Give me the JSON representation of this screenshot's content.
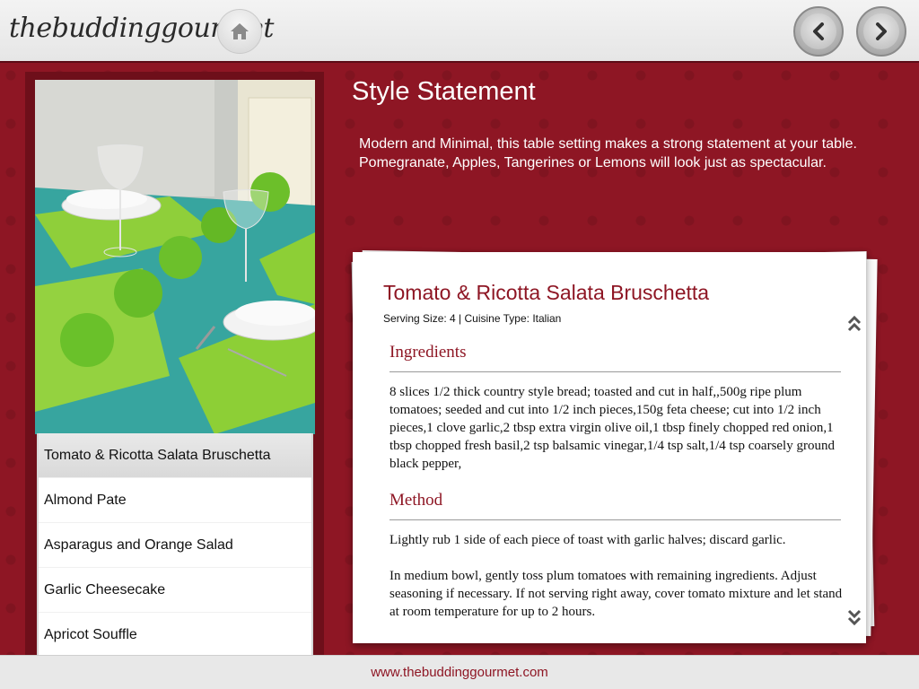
{
  "header": {
    "logo_text": "thebuddinggourmet",
    "home_icon": "home-icon",
    "prev_icon": "chevron-left-icon",
    "next_icon": "chevron-right-icon"
  },
  "feature": {
    "title": "Style Statement",
    "description": "Modern and Minimal, this table setting makes a strong statement at your table. Pomegranate, Apples, Tangerines or Lemons will look just as spectacular."
  },
  "recipe_list": {
    "items": [
      {
        "label": "Tomato & Ricotta Salata Bruschetta",
        "selected": true
      },
      {
        "label": "Almond Pate"
      },
      {
        "label": "Asparagus and Orange Salad"
      },
      {
        "label": "Garlic Cheesecake"
      },
      {
        "label": "Apricot Souffle"
      }
    ]
  },
  "recipe": {
    "title": "Tomato & Ricotta Salata Bruschetta",
    "meta": "Serving Size: 4 | Cuisine Type: Italian",
    "ingredients_heading": "Ingredients",
    "ingredients_text": "8 slices 1/2 thick country style bread; toasted and cut in half,,500g ripe plum tomatoes; seeded and cut into 1/2 inch pieces,150g feta cheese; cut into 1/2 inch pieces,1 clove garlic,2 tbsp extra virgin olive oil,1 tbsp finely chopped red onion,1 tbsp chopped fresh basil,2 tsp balsamic vinegar,1/4 tsp salt,1/4 tsp coarsely ground black pepper,",
    "method_heading": "Method",
    "method_para1": "Lightly rub 1 side of each piece of toast with garlic halves; discard garlic.",
    "method_para2": "In medium bowl, gently toss plum tomatoes with remaining ingredients. Adjust seasoning if necessary. If not serving right away, cover tomato mixture and let stand at room temperature for up to 2 hours."
  },
  "footer": {
    "url": "www.thebuddinggourmet.com"
  },
  "colors": {
    "brand": "#8e1624",
    "header_bg": "#eeeeee",
    "card_bg": "#ffffff"
  }
}
